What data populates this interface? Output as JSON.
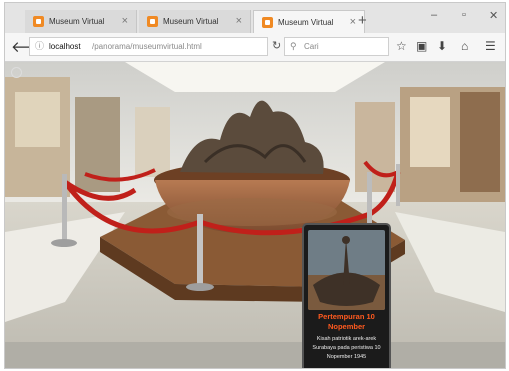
{
  "browser": {
    "tabs": [
      {
        "title": "Museum Virtual",
        "active": false
      },
      {
        "title": "Museum Virtual",
        "active": false
      },
      {
        "title": "Museum Virtual",
        "active": true
      }
    ],
    "new_tab_glyph": "+",
    "tab_close_glyph": "×",
    "window_controls": {
      "minimize": "–",
      "maximize": "▫",
      "close": "✕"
    },
    "address": {
      "host": "localhost",
      "path": "/panorama/museumvirtual.html"
    },
    "search_placeholder": "Cari",
    "toolbar_icons": [
      "star-icon",
      "library-icon",
      "download-icon",
      "home-icon",
      "menu-icon"
    ],
    "accent_color": "#f08a24"
  },
  "hotspot_card": {
    "title": "Pertempuran 10 Nopember",
    "description": "Kisah patriotik arek-arek Surabaya pada peristiwa 10 Nopember 1945",
    "title_color": "#ff5a1f"
  }
}
